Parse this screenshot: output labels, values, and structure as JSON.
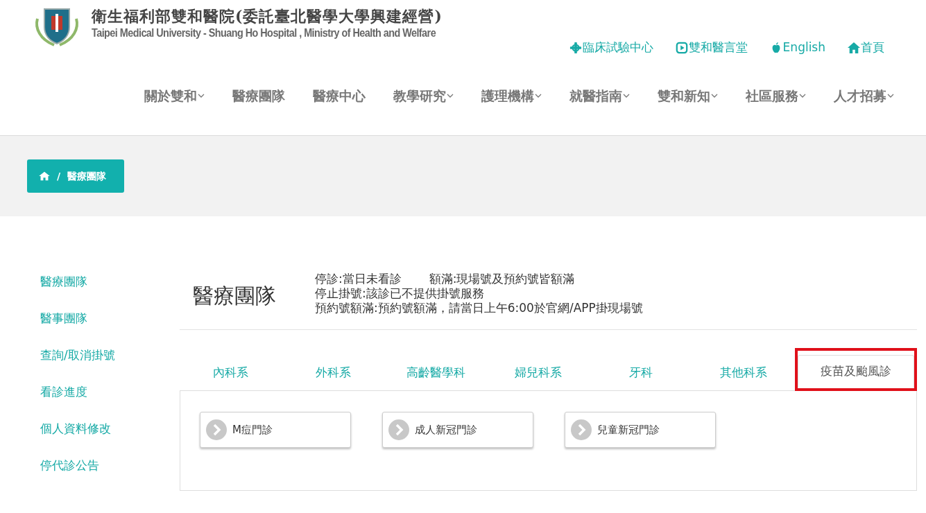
{
  "header": {
    "title_zh": "衛生福利部雙和醫院(委託臺北醫學大學興建經營)",
    "title_en": "Taipei Medical University - Shuang Ho Hospital , Ministry of Health and Welfare",
    "top_links": [
      {
        "kind": "crosshair",
        "label": "臨床試驗中心"
      },
      {
        "kind": "play",
        "label": "雙和醫言堂"
      },
      {
        "kind": "apple",
        "label": "English"
      },
      {
        "kind": "home",
        "label": "首頁"
      }
    ],
    "nav": [
      {
        "label": "關於雙和",
        "dropdown": true
      },
      {
        "label": "醫療團隊",
        "dropdown": false
      },
      {
        "label": "醫療中心",
        "dropdown": false
      },
      {
        "label": "教學研究",
        "dropdown": true
      },
      {
        "label": "護理機構",
        "dropdown": true
      },
      {
        "label": "就醫指南",
        "dropdown": true
      },
      {
        "label": "雙和新知",
        "dropdown": true
      },
      {
        "label": "社區服務",
        "dropdown": true
      },
      {
        "label": "人才招募",
        "dropdown": true
      }
    ]
  },
  "breadcrumb": {
    "separator": "/",
    "current": "醫療團隊"
  },
  "sidebar": {
    "items": [
      "醫療團隊",
      "醫事團隊",
      "查詢/取消掛號",
      "看診進度",
      "個人資料修改",
      "停代診公告"
    ]
  },
  "content": {
    "title": "醫療團隊",
    "legend": [
      [
        "停診:當日未看診",
        "額滿:現場號及預約號皆額滿"
      ],
      [
        "停止掛號:該診已不提供掛號服務"
      ],
      [
        "預約號額滿:預約號額滿，請當日上午6:00於官網/APP掛現場號"
      ]
    ],
    "tabs": [
      {
        "label": "內科系",
        "selected": false
      },
      {
        "label": "外科系",
        "selected": false
      },
      {
        "label": "高齡醫學科",
        "selected": false
      },
      {
        "label": "婦兒科系",
        "selected": false
      },
      {
        "label": "牙科",
        "selected": false
      },
      {
        "label": "其他科系",
        "selected": false
      },
      {
        "label": "疫苗及颱風診",
        "selected": true,
        "highlighted": true
      }
    ],
    "clinics": [
      "M痘門診",
      "成人新冠門診",
      "兒童新冠門診"
    ]
  }
}
